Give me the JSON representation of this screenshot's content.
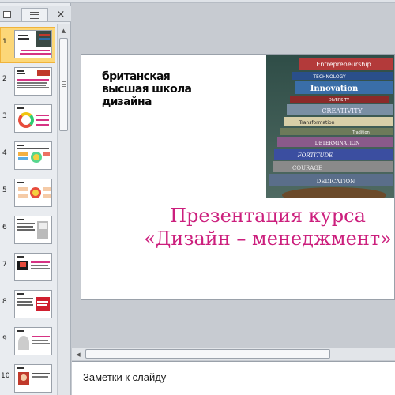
{
  "slides_pane": {
    "tab_outline_icon": "outline-icon",
    "tab_slides_icon": "slides-icon",
    "close_label": "×",
    "thumbnails": [
      {
        "number": "1"
      },
      {
        "number": "2"
      },
      {
        "number": "3"
      },
      {
        "number": "4"
      },
      {
        "number": "5"
      },
      {
        "number": "6"
      },
      {
        "number": "7"
      },
      {
        "number": "8"
      },
      {
        "number": "9"
      },
      {
        "number": "10"
      }
    ]
  },
  "slide": {
    "logo_lines": [
      "британская",
      "высшая школа",
      "дизайна"
    ],
    "book_labels": [
      "Entrepreneurship",
      "TECHNOLOGY",
      "Innovation",
      "DIVERSITY",
      "CREATIVITY",
      "Transformation",
      "Tradition",
      "DETERMINATION",
      "FORTITUDE",
      "COURAGE",
      "DEDICATION"
    ],
    "title_line1": "Презентация курса",
    "title_line2": "«Дизайн – менеджмент»"
  },
  "notes": {
    "placeholder": "Заметки к слайду"
  },
  "colors": {
    "title": "#cc1f7d",
    "selected_thumb": "#fcd778",
    "background": "#c7cbd1"
  }
}
